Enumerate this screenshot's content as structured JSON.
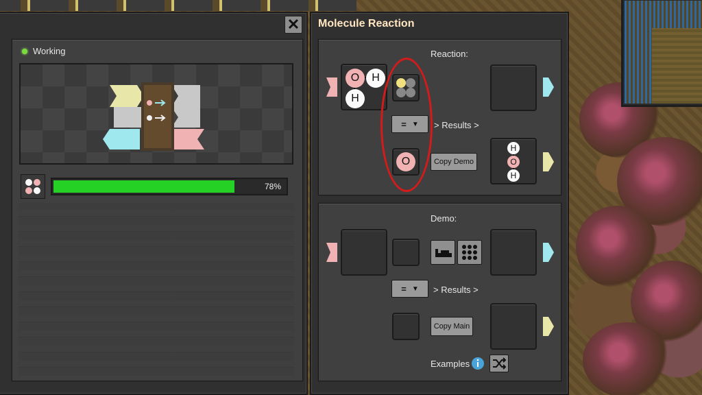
{
  "window": {
    "title": "Molecule Reaction",
    "close_label": "✕"
  },
  "status": {
    "text": "Working",
    "color": "#7adb3c"
  },
  "progress": {
    "percent_text": "78%",
    "fraction": 0.78,
    "fill_color": "#26d126"
  },
  "reaction": {
    "section_label": "Reaction:",
    "operator": "=",
    "results_label": "> Results >",
    "copy_button": "Copy Demo",
    "input_molecule": [
      "O",
      "H",
      "H"
    ],
    "selector_atom": "O",
    "output_molecule": [
      "H",
      "O",
      "H"
    ]
  },
  "demo": {
    "section_label": "Demo:",
    "operator": "=",
    "results_label": "> Results >",
    "copy_button": "Copy Main",
    "examples_label": "Examples"
  },
  "colors": {
    "port_pink": "#f0b2b2",
    "port_cyan": "#9ee8ee",
    "port_yellow": "#e8e6a8",
    "highlight": "#d41b1b"
  }
}
